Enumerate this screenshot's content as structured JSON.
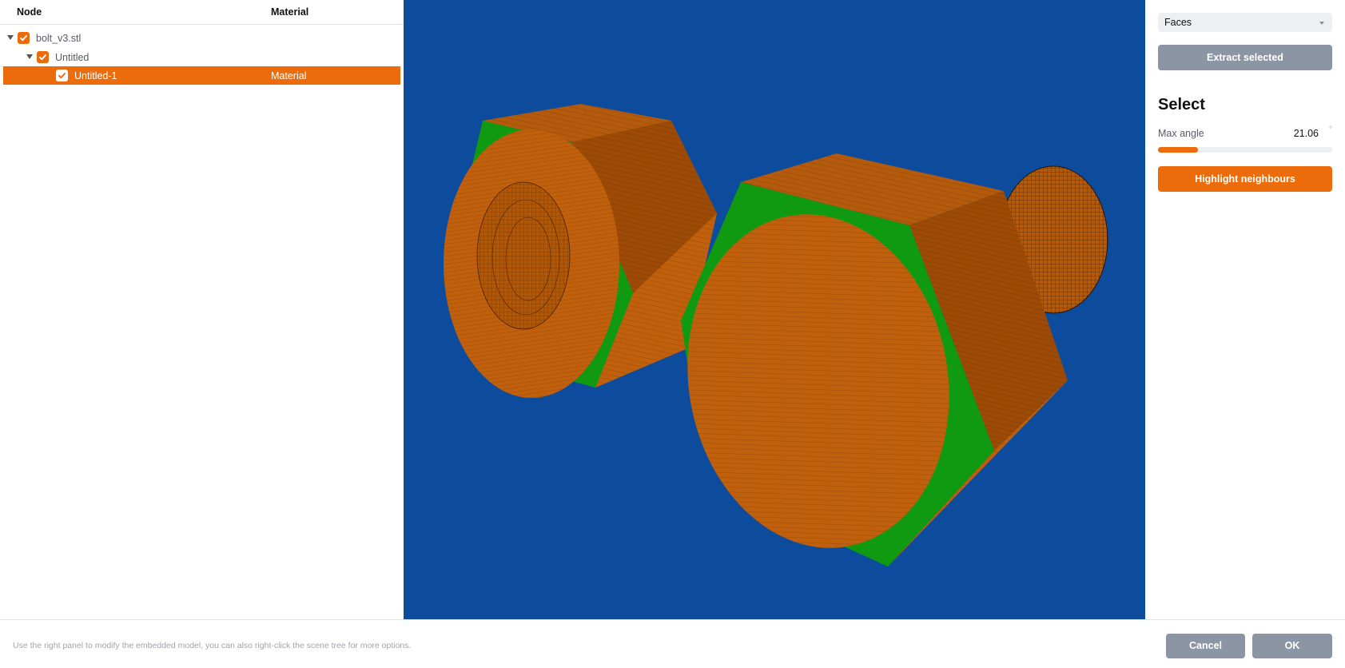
{
  "tree": {
    "columns": {
      "node": "Node",
      "material": "Material"
    },
    "rows": [
      {
        "label": "bolt_v3.stl",
        "material": "",
        "checked": true,
        "expanded": true,
        "depth": 0,
        "selected": false
      },
      {
        "label": "Untitled",
        "material": "",
        "checked": true,
        "expanded": true,
        "depth": 1,
        "selected": false
      },
      {
        "label": "Untitled-1",
        "material": "Material",
        "checked": true,
        "expanded": false,
        "depth": 2,
        "selected": true
      }
    ]
  },
  "viewport": {
    "background": "#0d4c9d",
    "model_color": "#c0600d",
    "selection_color": "#0f9a12",
    "objects": [
      "nut",
      "bolt"
    ]
  },
  "right_panel": {
    "mode_select": {
      "value": "Faces"
    },
    "extract_label": "Extract selected",
    "section_title": "Select",
    "max_angle": {
      "label": "Max angle",
      "value": "21.06",
      "unit": "°",
      "fraction": 0.23
    },
    "highlight_label": "Highlight neighbours"
  },
  "footer": {
    "hint": "Use the right panel to modify the embedded model, you can also right-click the scene tree for more options.",
    "cancel_label": "Cancel",
    "ok_label": "OK"
  },
  "colors": {
    "accent": "#ec6b0b",
    "button_gray": "#8c95a3"
  }
}
